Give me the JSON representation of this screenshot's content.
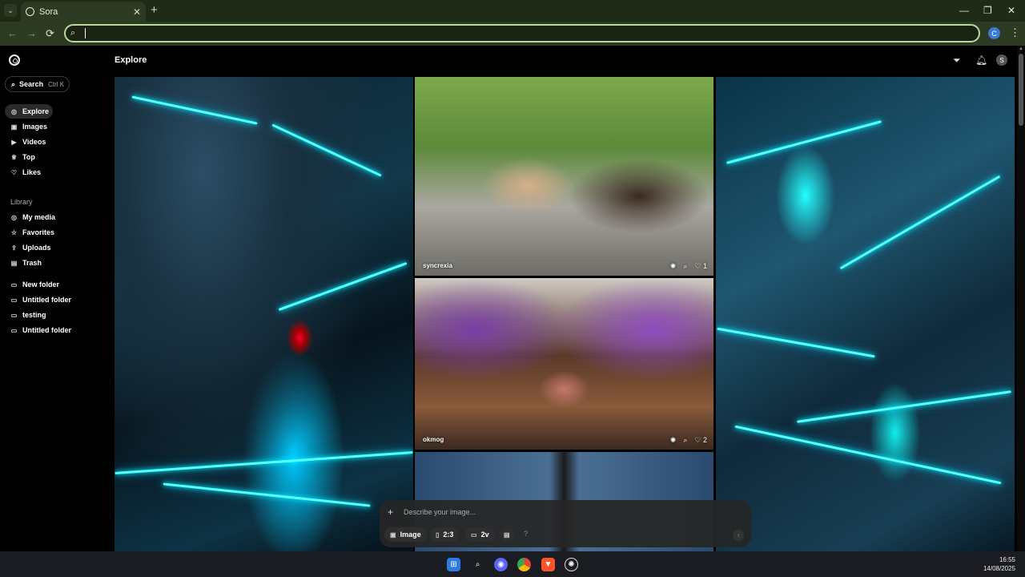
{
  "browser": {
    "tab_title": "Sora",
    "new_tab": "+",
    "close_tab": "✕",
    "window_controls": [
      "—",
      "❐",
      "✕"
    ],
    "nav": [
      "←",
      "→",
      "⟳"
    ],
    "profile_initial": "C",
    "menu": "⋮"
  },
  "sidebar": {
    "search_label": "Search",
    "search_shortcut": "Ctrl K",
    "nav_items": [
      {
        "label": "Explore",
        "icon": "compass-icon",
        "glyph": "◎"
      },
      {
        "label": "Images",
        "icon": "image-icon",
        "glyph": "▣"
      },
      {
        "label": "Videos",
        "icon": "video-icon",
        "glyph": "▶"
      },
      {
        "label": "Top",
        "icon": "trophy-icon",
        "glyph": "♕"
      },
      {
        "label": "Likes",
        "icon": "heart-icon",
        "glyph": "♡"
      }
    ],
    "library_label": "Library",
    "library_items": [
      {
        "label": "My media",
        "icon": "media-icon",
        "glyph": "◎"
      },
      {
        "label": "Favorites",
        "icon": "star-icon",
        "glyph": "☆"
      },
      {
        "label": "Uploads",
        "icon": "upload-icon",
        "glyph": "⇪"
      },
      {
        "label": "Trash",
        "icon": "trash-icon",
        "glyph": "▤"
      }
    ],
    "folders": [
      {
        "label": "New folder",
        "icon": "folder-icon",
        "glyph": "▭"
      },
      {
        "label": "Untitled folder",
        "icon": "folder-icon",
        "glyph": "▭"
      },
      {
        "label": "testing",
        "icon": "folder-icon",
        "glyph": "▭"
      },
      {
        "label": "Untitled folder",
        "icon": "folder-icon",
        "glyph": "▭"
      }
    ]
  },
  "header": {
    "title": "Explore",
    "avatar_initial": "S"
  },
  "feed": {
    "cards": [
      {
        "user": "syncrexia",
        "likes": "1"
      },
      {
        "user": "okmog",
        "likes": "2"
      }
    ]
  },
  "composer": {
    "placeholder": "Describe your image...",
    "type_label": "Image",
    "aspect_label": "2:3",
    "variations_label": "2v",
    "help": "?"
  },
  "taskbar": {
    "time": "16:55",
    "date": "14/08/2025"
  }
}
